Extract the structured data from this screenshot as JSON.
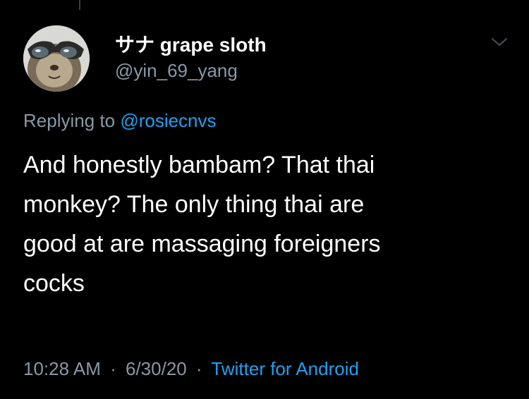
{
  "tweet": {
    "display_name": "サナ grape sloth",
    "handle": "@yin_69_yang",
    "replying_prefix": "Replying to",
    "replying_to": "@rosiecnvs",
    "text_lines": [
      "And honestly bambam? That thai",
      "monkey? The only thing thai are",
      "good at are massaging foreigners",
      "cocks"
    ],
    "time": "10:28 AM",
    "separator": "·",
    "date": "6/30/20",
    "source": "Twitter for Android"
  },
  "icons": {
    "avatar": "sloth-with-sunglasses-avatar",
    "menu": "chevron-down-icon"
  },
  "colors": {
    "background": "#000000",
    "primary_text": "#ffffff",
    "secondary_text": "#8899a6",
    "accent": "#1da1f2"
  }
}
